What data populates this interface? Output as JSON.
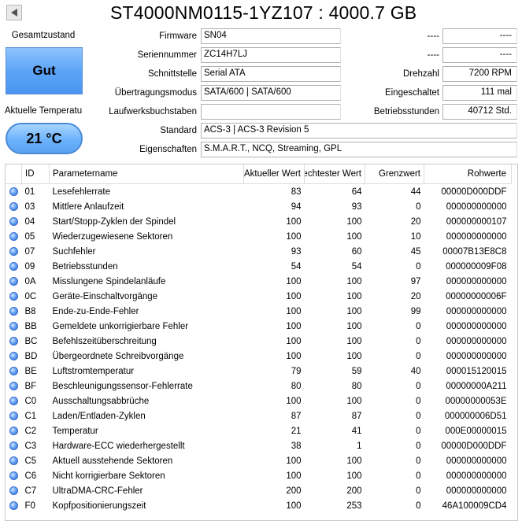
{
  "header": {
    "title": "ST4000NM0115-1YZ107 : 4000.7 GB"
  },
  "status": {
    "health_label": "Gesamtzustand",
    "health_value": "Gut",
    "health_color": "#5ca4f7",
    "temp_label": "Aktuelle Temperatu",
    "temp_value": "21 °C"
  },
  "fields": {
    "firmware": {
      "label": "Firmware",
      "value": "SN04"
    },
    "serial": {
      "label": "Seriennummer",
      "value": "ZC14H7LJ"
    },
    "interface": {
      "label": "Schnittstelle",
      "value": "Serial ATA"
    },
    "transfer": {
      "label": "Übertragungsmodus",
      "value": "SATA/600 | SATA/600"
    },
    "drive_letters": {
      "label": "Laufwerksbuchstaben",
      "value": ""
    },
    "standard": {
      "label": "Standard",
      "value": "ACS-3 | ACS-3 Revision 5"
    },
    "features": {
      "label": "Eigenschaften",
      "value": "S.M.A.R.T., NCQ, Streaming, GPL"
    }
  },
  "right_fields": {
    "blank1": {
      "label": "----",
      "value": "----"
    },
    "blank2": {
      "label": "----",
      "value": "----"
    },
    "rpm": {
      "label": "Drehzahl",
      "value": "7200 RPM"
    },
    "power_on_count": {
      "label": "Eingeschaltet",
      "value": "111 mal"
    },
    "power_on_hours": {
      "label": "Betriebsstunden",
      "value": "40712 Std."
    }
  },
  "table": {
    "headers": {
      "id": "ID",
      "name": "Parametername",
      "current": "Aktueller Wert",
      "worst": "Schlechtester Wert",
      "threshold": "Grenzwert",
      "raw": "Rohwerte"
    },
    "rows": [
      {
        "id": "01",
        "name": "Lesefehlerrate",
        "cur": "83",
        "worst": "64",
        "thr": "44",
        "raw": "00000D000DDF"
      },
      {
        "id": "03",
        "name": "Mittlere Anlaufzeit",
        "cur": "94",
        "worst": "93",
        "thr": "0",
        "raw": "000000000000"
      },
      {
        "id": "04",
        "name": "Start/Stopp-Zyklen der Spindel",
        "cur": "100",
        "worst": "100",
        "thr": "20",
        "raw": "000000000107"
      },
      {
        "id": "05",
        "name": "Wiederzugewiesene Sektoren",
        "cur": "100",
        "worst": "100",
        "thr": "10",
        "raw": "000000000000"
      },
      {
        "id": "07",
        "name": "Suchfehler",
        "cur": "93",
        "worst": "60",
        "thr": "45",
        "raw": "00007B13E8C8"
      },
      {
        "id": "09",
        "name": "Betriebsstunden",
        "cur": "54",
        "worst": "54",
        "thr": "0",
        "raw": "000000009F08"
      },
      {
        "id": "0A",
        "name": "Misslungene Spindelanläufe",
        "cur": "100",
        "worst": "100",
        "thr": "97",
        "raw": "000000000000"
      },
      {
        "id": "0C",
        "name": "Geräte-Einschaltvorgänge",
        "cur": "100",
        "worst": "100",
        "thr": "20",
        "raw": "00000000006F"
      },
      {
        "id": "B8",
        "name": "Ende-zu-Ende-Fehler",
        "cur": "100",
        "worst": "100",
        "thr": "99",
        "raw": "000000000000"
      },
      {
        "id": "BB",
        "name": "Gemeldete unkorrigierbare Fehler",
        "cur": "100",
        "worst": "100",
        "thr": "0",
        "raw": "000000000000"
      },
      {
        "id": "BC",
        "name": "Befehlszeitüberschreitung",
        "cur": "100",
        "worst": "100",
        "thr": "0",
        "raw": "000000000000"
      },
      {
        "id": "BD",
        "name": "Übergeordnete Schreibvorgänge",
        "cur": "100",
        "worst": "100",
        "thr": "0",
        "raw": "000000000000"
      },
      {
        "id": "BE",
        "name": "Luftstromtemperatur",
        "cur": "79",
        "worst": "59",
        "thr": "40",
        "raw": "000015120015"
      },
      {
        "id": "BF",
        "name": "Beschleunigungssensor-Fehlerrate",
        "cur": "80",
        "worst": "80",
        "thr": "0",
        "raw": "00000000A211"
      },
      {
        "id": "C0",
        "name": "Ausschaltungsabbrüche",
        "cur": "100",
        "worst": "100",
        "thr": "0",
        "raw": "00000000053E"
      },
      {
        "id": "C1",
        "name": "Laden/Entladen-Zyklen",
        "cur": "87",
        "worst": "87",
        "thr": "0",
        "raw": "000000006D51"
      },
      {
        "id": "C2",
        "name": "Temperatur",
        "cur": "21",
        "worst": "41",
        "thr": "0",
        "raw": "000E00000015"
      },
      {
        "id": "C3",
        "name": "Hardware-ECC wiederhergestellt",
        "cur": "38",
        "worst": "1",
        "thr": "0",
        "raw": "00000D000DDF"
      },
      {
        "id": "C5",
        "name": "Aktuell ausstehende Sektoren",
        "cur": "100",
        "worst": "100",
        "thr": "0",
        "raw": "000000000000"
      },
      {
        "id": "C6",
        "name": "Nicht korrigierbare Sektoren",
        "cur": "100",
        "worst": "100",
        "thr": "0",
        "raw": "000000000000"
      },
      {
        "id": "C7",
        "name": "UltraDMA-CRC-Fehler",
        "cur": "200",
        "worst": "200",
        "thr": "0",
        "raw": "000000000000"
      },
      {
        "id": "F0",
        "name": "Kopfpositionierungszeit",
        "cur": "100",
        "worst": "253",
        "thr": "0",
        "raw": "46A100009CD4"
      }
    ]
  },
  "icons": {
    "status_dot": "status-good-icon",
    "back": "triangle-left-icon"
  }
}
